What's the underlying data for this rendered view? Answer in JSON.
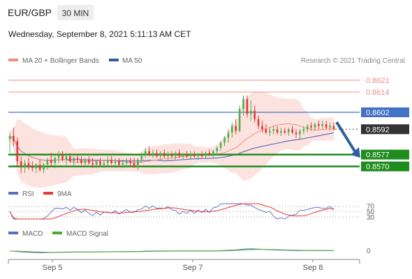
{
  "header": {
    "symbol": "EUR/GBP",
    "timeframe": "30 MIN",
    "datetime": "Wednesday, September 8, 2021 5:11:13 AM CET"
  },
  "legend": {
    "ma20_label": "MA 20 + Bollinger Bands",
    "ma50_label": "MA 50",
    "credit": "Research © 2021 Trading Central"
  },
  "colors": {
    "up_candle": "#4caf50",
    "down_candle": "#e53935",
    "ma20": "#f28c82",
    "bollinger_fill": "#fde3df",
    "ma50": "#5a6fc0",
    "resistance": "#f28c82",
    "pivot": "#4472c4",
    "support": "#1e8c1e",
    "arrow": "#2e5d9e",
    "rsi": "#5a6fc0",
    "rsi_ma": "#e53935",
    "macd": "#5a6fc0",
    "macd_signal": "#4ea72e"
  },
  "chart_data": [
    {
      "type": "candlestick",
      "title": "EUR/GBP 30 MIN",
      "x_tick_labels": [
        "Sep 5",
        "Sep 7",
        "Sep 8"
      ],
      "ylim": [
        0.8562,
        0.8628
      ],
      "last_price": 0.8592,
      "levels": [
        {
          "value": 0.8621,
          "role": "resistance",
          "label": "0.8621"
        },
        {
          "value": 0.8614,
          "role": "resistance",
          "label": "0.8614"
        },
        {
          "value": 0.8602,
          "role": "pivot",
          "label": "0.8602"
        },
        {
          "value": 0.8592,
          "role": "last",
          "label": "0.8592"
        },
        {
          "value": 0.8577,
          "role": "support",
          "label": "0.8577"
        },
        {
          "value": 0.857,
          "role": "support",
          "label": "0.8570"
        }
      ],
      "arrow": {
        "from": 0.8592,
        "to": 0.857,
        "direction": "down"
      },
      "candles": [
        [
          0.8586,
          0.859,
          0.8578,
          0.8588
        ],
        [
          0.8588,
          0.8593,
          0.8582,
          0.8585
        ],
        [
          0.8585,
          0.8587,
          0.857,
          0.8573
        ],
        [
          0.8573,
          0.8576,
          0.8566,
          0.857
        ],
        [
          0.857,
          0.8574,
          0.8566,
          0.8572
        ],
        [
          0.8572,
          0.8575,
          0.8568,
          0.857
        ],
        [
          0.857,
          0.8573,
          0.8567,
          0.8569
        ],
        [
          0.8569,
          0.8572,
          0.8566,
          0.8571
        ],
        [
          0.8571,
          0.8574,
          0.8567,
          0.8568
        ],
        [
          0.8568,
          0.8572,
          0.8566,
          0.8571
        ],
        [
          0.8571,
          0.8575,
          0.8568,
          0.8574
        ],
        [
          0.8574,
          0.8578,
          0.857,
          0.8572
        ],
        [
          0.8572,
          0.8576,
          0.8569,
          0.8575
        ],
        [
          0.8575,
          0.8579,
          0.8572,
          0.8577
        ],
        [
          0.8577,
          0.8579,
          0.8573,
          0.8574
        ],
        [
          0.8574,
          0.8578,
          0.8571,
          0.8576
        ],
        [
          0.8576,
          0.8578,
          0.8572,
          0.8573
        ],
        [
          0.8573,
          0.8576,
          0.857,
          0.8575
        ],
        [
          0.8575,
          0.8577,
          0.8572,
          0.8574
        ],
        [
          0.8574,
          0.8576,
          0.8571,
          0.8572
        ],
        [
          0.8572,
          0.8575,
          0.857,
          0.8574
        ],
        [
          0.8574,
          0.8576,
          0.8571,
          0.8572
        ],
        [
          0.8572,
          0.8575,
          0.8569,
          0.8571
        ],
        [
          0.8571,
          0.8574,
          0.8569,
          0.8573
        ],
        [
          0.8573,
          0.8575,
          0.857,
          0.8571
        ],
        [
          0.8571,
          0.8574,
          0.8569,
          0.8572
        ],
        [
          0.8572,
          0.8576,
          0.857,
          0.8574
        ],
        [
          0.8574,
          0.8576,
          0.8571,
          0.8572
        ],
        [
          0.8572,
          0.8575,
          0.8569,
          0.8573
        ],
        [
          0.8573,
          0.8575,
          0.857,
          0.8571
        ],
        [
          0.8571,
          0.8574,
          0.8569,
          0.8572
        ],
        [
          0.8572,
          0.8575,
          0.857,
          0.8573
        ],
        [
          0.8573,
          0.8575,
          0.857,
          0.8572
        ],
        [
          0.8572,
          0.8575,
          0.8569,
          0.857
        ],
        [
          0.857,
          0.8575,
          0.8568,
          0.8574
        ],
        [
          0.8574,
          0.8578,
          0.8572,
          0.8577
        ],
        [
          0.8577,
          0.8581,
          0.8575,
          0.8579
        ],
        [
          0.8579,
          0.8582,
          0.8576,
          0.8577
        ],
        [
          0.8577,
          0.858,
          0.8575,
          0.8578
        ],
        [
          0.8578,
          0.858,
          0.8575,
          0.8576
        ],
        [
          0.8576,
          0.8579,
          0.8574,
          0.8578
        ],
        [
          0.8578,
          0.858,
          0.8575,
          0.8576
        ],
        [
          0.8576,
          0.8579,
          0.8574,
          0.8577
        ],
        [
          0.8577,
          0.8579,
          0.8575,
          0.8576
        ],
        [
          0.8576,
          0.8579,
          0.8574,
          0.8578
        ],
        [
          0.8578,
          0.858,
          0.8575,
          0.8576
        ],
        [
          0.8576,
          0.8578,
          0.8574,
          0.8577
        ],
        [
          0.8577,
          0.8579,
          0.8575,
          0.8576
        ],
        [
          0.8576,
          0.8579,
          0.8574,
          0.8577
        ],
        [
          0.8577,
          0.8579,
          0.8575,
          0.8576
        ],
        [
          0.8576,
          0.8578,
          0.8574,
          0.8577
        ],
        [
          0.8577,
          0.8579,
          0.8575,
          0.8576
        ],
        [
          0.8576,
          0.8579,
          0.8575,
          0.8578
        ],
        [
          0.8578,
          0.858,
          0.8576,
          0.8577
        ],
        [
          0.8577,
          0.858,
          0.8575,
          0.8579
        ],
        [
          0.8579,
          0.8582,
          0.8577,
          0.8581
        ],
        [
          0.8581,
          0.8585,
          0.8579,
          0.8584
        ],
        [
          0.8584,
          0.8588,
          0.8582,
          0.8587
        ],
        [
          0.8587,
          0.8592,
          0.8584,
          0.859
        ],
        [
          0.859,
          0.8596,
          0.8587,
          0.8594
        ],
        [
          0.8594,
          0.8598,
          0.8589,
          0.8591
        ],
        [
          0.8591,
          0.8606,
          0.859,
          0.8604
        ],
        [
          0.8604,
          0.8612,
          0.86,
          0.861
        ],
        [
          0.861,
          0.8612,
          0.8599,
          0.8601
        ],
        [
          0.8601,
          0.8609,
          0.8597,
          0.8603
        ],
        [
          0.8603,
          0.8606,
          0.8596,
          0.8598
        ],
        [
          0.8598,
          0.86,
          0.8592,
          0.8594
        ],
        [
          0.8594,
          0.8597,
          0.859,
          0.8592
        ],
        [
          0.8592,
          0.8595,
          0.8589,
          0.859
        ],
        [
          0.859,
          0.8593,
          0.8588,
          0.8591
        ],
        [
          0.8591,
          0.8594,
          0.8589,
          0.8592
        ],
        [
          0.8592,
          0.8594,
          0.8589,
          0.859
        ],
        [
          0.859,
          0.8593,
          0.8588,
          0.8591
        ],
        [
          0.8591,
          0.8593,
          0.8589,
          0.859
        ],
        [
          0.859,
          0.8593,
          0.8588,
          0.8592
        ],
        [
          0.8592,
          0.8594,
          0.8589,
          0.859
        ],
        [
          0.859,
          0.8592,
          0.8587,
          0.8589
        ],
        [
          0.8589,
          0.8592,
          0.8586,
          0.8591
        ],
        [
          0.8591,
          0.8594,
          0.8589,
          0.8592
        ],
        [
          0.8592,
          0.8595,
          0.859,
          0.8594
        ],
        [
          0.8594,
          0.8596,
          0.8591,
          0.8593
        ],
        [
          0.8593,
          0.8596,
          0.8591,
          0.8595
        ],
        [
          0.8595,
          0.8597,
          0.8592,
          0.8594
        ],
        [
          0.8594,
          0.8597,
          0.8592,
          0.8595
        ],
        [
          0.8595,
          0.8597,
          0.8592,
          0.8593
        ],
        [
          0.8593,
          0.8596,
          0.8591,
          0.8594
        ],
        [
          0.8594,
          0.8596,
          0.8591,
          0.8592
        ]
      ]
    },
    {
      "type": "line",
      "title": "RSI",
      "series": [
        {
          "name": "RSI"
        },
        {
          "name": "9MA"
        }
      ],
      "y_tick_labels": [
        "70",
        "50",
        "30"
      ],
      "ylim": [
        20,
        80
      ]
    },
    {
      "type": "line",
      "title": "MACD",
      "series": [
        {
          "name": "MACD"
        },
        {
          "name": "MACD Signal"
        }
      ],
      "y_tick_labels": [
        "0"
      ]
    }
  ]
}
